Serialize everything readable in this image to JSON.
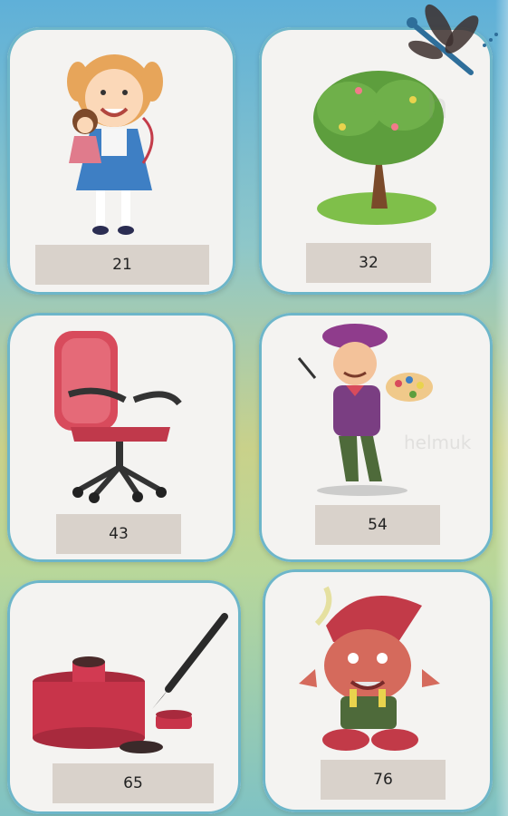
{
  "cards": [
    {
      "label": "21",
      "icon": "girl-doll-icon"
    },
    {
      "label": "32",
      "icon": "tree-icon"
    },
    {
      "label": "43",
      "icon": "office-chair-icon"
    },
    {
      "label": "54",
      "icon": "painter-icon"
    },
    {
      "label": "65",
      "icon": "ink-pot-brush-icon"
    },
    {
      "label": "76",
      "icon": "gnome-icon"
    }
  ],
  "colors": {
    "card_bg": "#f4f3f1",
    "card_border": "#6db6c9",
    "label_bg": "#d9d2cb"
  }
}
